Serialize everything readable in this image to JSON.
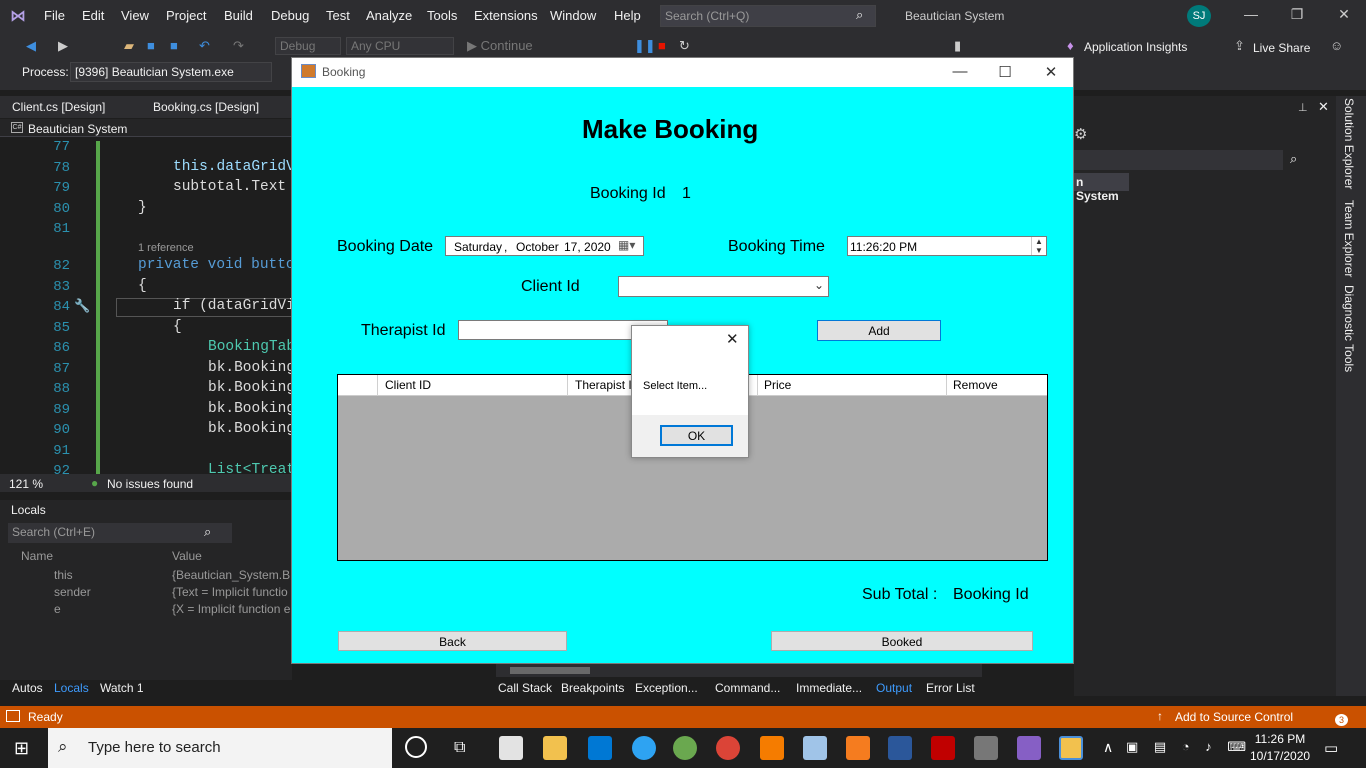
{
  "vs": {
    "menu": [
      "File",
      "Edit",
      "View",
      "Project",
      "Build",
      "Debug",
      "Test",
      "Analyze",
      "Tools",
      "Extensions",
      "Window",
      "Help"
    ],
    "search_placeholder": "Search (Ctrl+Q)",
    "title": "Beautician System",
    "avatar": "SJ",
    "toolbar": {
      "config": "Debug",
      "platform": "Any CPU",
      "continue": "Continue",
      "app_insights": "Application Insights",
      "live_share": "Live Share"
    },
    "process": {
      "label": "Process:",
      "value": "[9396] Beautician System.exe"
    },
    "doc_tabs": [
      "Client.cs [Design]",
      "Booking.cs [Design]"
    ],
    "code_header": "Beautician System",
    "code_lines": [
      {
        "n": "77",
        "text": ""
      },
      {
        "n": "78",
        "text": "this.dataGridV"
      },
      {
        "n": "79",
        "text": "subtotal.Text "
      },
      {
        "n": "80",
        "text": "}"
      },
      {
        "n": "81",
        "text": ""
      },
      {
        "n": "",
        "text": "1 reference"
      },
      {
        "n": "82",
        "text": "private void butto"
      },
      {
        "n": "83",
        "text": "{"
      },
      {
        "n": "84",
        "text": "if (dataGridVi"
      },
      {
        "n": "85",
        "text": "{"
      },
      {
        "n": "86",
        "text": "BookingTab"
      },
      {
        "n": "87",
        "text": "bk.Booking"
      },
      {
        "n": "88",
        "text": "bk.Booking"
      },
      {
        "n": "89",
        "text": "bk.Booking"
      },
      {
        "n": "90",
        "text": "bk.Booking"
      },
      {
        "n": "91",
        "text": ""
      },
      {
        "n": "92",
        "text": "List<Treat"
      }
    ],
    "zoom": "121 %",
    "issues": "No issues found",
    "locals": {
      "title": "Locals",
      "search_placeholder": "Search (Ctrl+E)",
      "col_name": "Name",
      "col_value": "Value",
      "rows": [
        {
          "name": "this",
          "value": "{Beautician_System.Bo"
        },
        {
          "name": "sender",
          "value": "{Text = Implicit functio"
        },
        {
          "name": "e",
          "value": "{X = Implicit function e"
        }
      ]
    },
    "bottom_tabs_left": [
      "Autos",
      "Locals",
      "Watch 1"
    ],
    "bottom_tabs_right": [
      "Call Stack",
      "Breakpoints",
      "Exception...",
      "Command...",
      "Immediate...",
      "Output",
      "Error List"
    ],
    "solution_item": "n System",
    "side_tabs": [
      "Solution Explorer",
      "Team Explorer",
      "Diagnostic Tools"
    ],
    "status_ready": "Ready",
    "status_source": "Add to Source Control",
    "notif_count": "3"
  },
  "taskbar": {
    "search_placeholder": "Type here to search",
    "time": "11:26 PM",
    "date": "10/17/2020"
  },
  "form": {
    "window_title": "Booking",
    "heading": "Make Booking",
    "booking_id_label": "Booking Id",
    "booking_id_value": "1",
    "booking_date_label": "Booking Date",
    "date_day": "Saturday",
    "date_sep": ",",
    "date_month": "October",
    "date_rest": "17, 2020",
    "booking_time_label": "Booking Time",
    "time_value": "11:26:20 PM",
    "client_id_label": "Client Id",
    "client_id_value": "",
    "therapist_id_label": "Therapist Id",
    "therapist_id_value": "",
    "add_button": "Add",
    "grid_columns": [
      "",
      "Client ID",
      "Therapist ID",
      "Price",
      "Remove"
    ],
    "subtotal_label": "Sub Total :",
    "subtotal_value": "Booking Id",
    "back_button": "Back",
    "booked_button": "Booked"
  },
  "msgbox": {
    "text": "Select Item...",
    "ok_button": "OK"
  },
  "colors": {
    "form_bg": "#00ffff",
    "status_bar": "#ca5100",
    "vs_bg": "#2d2d30",
    "grid_bg": "#ababab"
  }
}
